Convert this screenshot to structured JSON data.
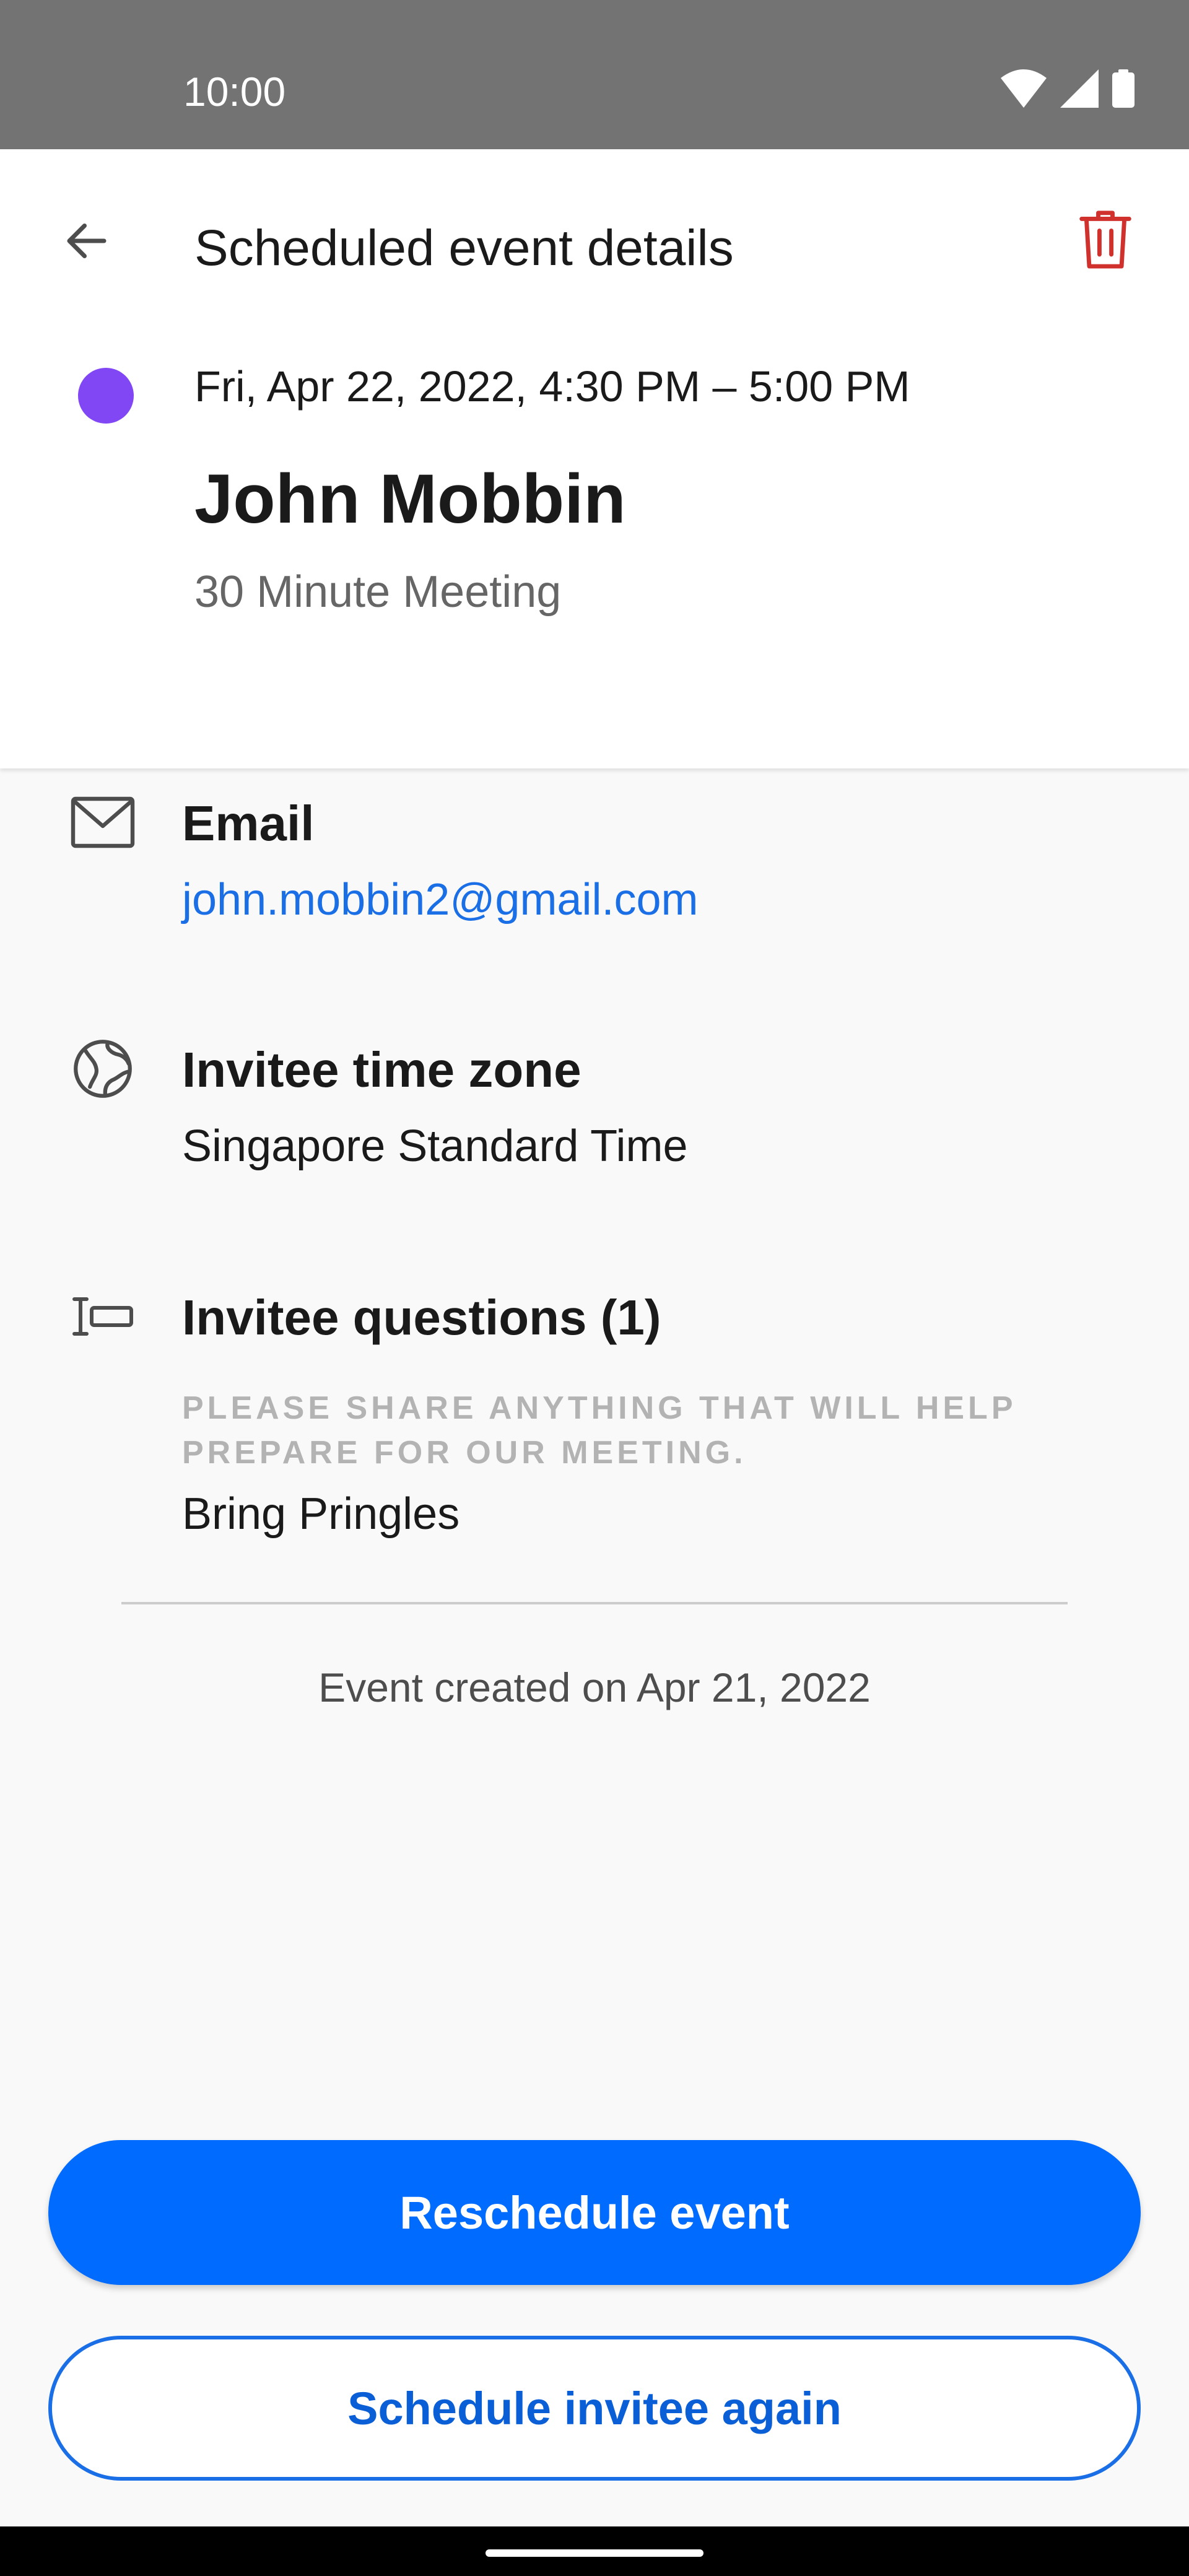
{
  "status_bar": {
    "time": "10:00",
    "icons": [
      "wifi-icon",
      "signal-icon",
      "battery-icon"
    ]
  },
  "app_bar": {
    "title": "Scheduled event details",
    "back_icon": "arrow-back-icon",
    "delete_icon": "trash-icon"
  },
  "event": {
    "color": "#8247f5",
    "datetime": "Fri, Apr 22, 2022, 4:30 PM – 5:00 PM",
    "invitee_name": "John Mobbin",
    "type": "30 Minute Meeting"
  },
  "details": {
    "email": {
      "icon": "mail-icon",
      "title": "Email",
      "value": "john.mobbin2@gmail.com"
    },
    "timezone": {
      "icon": "globe-icon",
      "title": "Invitee time zone",
      "value": "Singapore Standard Time"
    },
    "questions": {
      "icon": "text-field-icon",
      "title": "Invitee questions (1)",
      "items": [
        {
          "question": "PLEASE SHARE ANYTHING THAT WILL HELP PREPARE FOR OUR MEETING.",
          "answer": "Bring Pringles"
        }
      ]
    }
  },
  "created_text": "Event created on Apr 21, 2022",
  "actions": {
    "primary_label": "Reschedule event",
    "secondary_label": "Schedule invitee again"
  },
  "colors": {
    "accent": "#006bff",
    "link": "#1a6ee6",
    "danger": "#d0312d"
  }
}
